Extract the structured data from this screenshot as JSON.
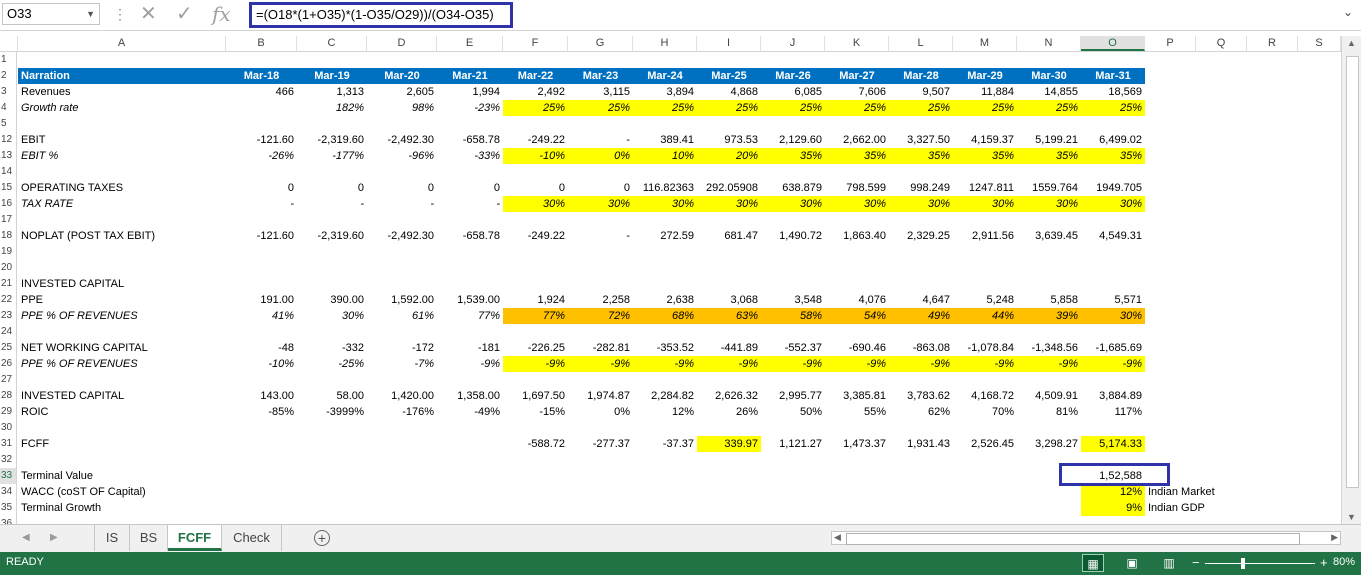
{
  "formula_bar": {
    "name_box": "O33",
    "formula": "=(O18*(1+O35)*(1-O35/O29))/(O34-O35)",
    "icons": [
      "cancel-icon",
      "enter-icon",
      "function-icon"
    ]
  },
  "columns": [
    "A",
    "B",
    "C",
    "D",
    "E",
    "F",
    "G",
    "H",
    "I",
    "J",
    "K",
    "L",
    "M",
    "N",
    "O",
    "P",
    "Q",
    "R",
    "S"
  ],
  "selected_column": "O",
  "selected_row": "33",
  "rows": [
    {
      "n": "1",
      "cells": []
    },
    {
      "n": "2",
      "hdr": true,
      "cells": [
        "Narration",
        "Mar-18",
        "Mar-19",
        "Mar-20",
        "Mar-21",
        "Mar-22",
        "Mar-23",
        "Mar-24",
        "Mar-25",
        "Mar-26",
        "Mar-27",
        "Mar-28",
        "Mar-29",
        "Mar-30",
        "Mar-31"
      ]
    },
    {
      "n": "3",
      "cells": [
        "Revenues",
        "466",
        "1,313",
        "2,605",
        "1,994",
        "2,492",
        "3,115",
        "3,894",
        "4,868",
        "6,085",
        "7,606",
        "9,507",
        "11,884",
        "14,855",
        "18,569"
      ]
    },
    {
      "n": "4",
      "italic": true,
      "fill": "F-O",
      "fillc": "yel",
      "cells": [
        "Growth rate",
        "",
        "182%",
        "98%",
        "-23%",
        "25%",
        "25%",
        "25%",
        "25%",
        "25%",
        "25%",
        "25%",
        "25%",
        "25%",
        "25%"
      ]
    },
    {
      "n": "5",
      "cells": []
    },
    {
      "n": "12",
      "cells": [
        "EBIT",
        "-121.60",
        "-2,319.60",
        "-2,492.30",
        "-658.78",
        "-249.22",
        "-",
        "389.41",
        "973.53",
        "2,129.60",
        "2,662.00",
        "3,327.50",
        "4,159.37",
        "5,199.21",
        "6,499.02"
      ]
    },
    {
      "n": "13",
      "italic": true,
      "fill": "F-O",
      "fillc": "yel",
      "cells": [
        "EBIT %",
        "-26%",
        "-177%",
        "-96%",
        "-33%",
        "-10%",
        "0%",
        "10%",
        "20%",
        "35%",
        "35%",
        "35%",
        "35%",
        "35%",
        "35%"
      ]
    },
    {
      "n": "14",
      "cells": []
    },
    {
      "n": "15",
      "cells": [
        "OPERATING TAXES",
        "0",
        "0",
        "0",
        "0",
        "0",
        "0",
        "116.82363",
        "292.05908",
        "638.879",
        "798.599",
        "998.249",
        "1247.811",
        "1559.764",
        "1949.705"
      ]
    },
    {
      "n": "16",
      "italic": true,
      "fill": "F-O",
      "fillc": "yel",
      "cells": [
        "TAX RATE",
        "-",
        "-",
        "-",
        "-",
        "30%",
        "30%",
        "30%",
        "30%",
        "30%",
        "30%",
        "30%",
        "30%",
        "30%",
        "30%"
      ]
    },
    {
      "n": "17",
      "cells": []
    },
    {
      "n": "18",
      "cells": [
        "NOPLAT (POST TAX EBIT)",
        "-121.60",
        "-2,319.60",
        "-2,492.30",
        "-658.78",
        "-249.22",
        "-",
        "272.59",
        "681.47",
        "1,490.72",
        "1,863.40",
        "2,329.25",
        "2,911.56",
        "3,639.45",
        "4,549.31"
      ]
    },
    {
      "n": "19",
      "cells": []
    },
    {
      "n": "20",
      "cells": []
    },
    {
      "n": "21",
      "cells": [
        "INVESTED CAPITAL"
      ]
    },
    {
      "n": "22",
      "cells": [
        "PPE",
        "191.00",
        "390.00",
        "1,592.00",
        "1,539.00",
        "1,924",
        "2,258",
        "2,638",
        "3,068",
        "3,548",
        "4,076",
        "4,647",
        "5,248",
        "5,858",
        "5,571"
      ]
    },
    {
      "n": "23",
      "italic": true,
      "fill": "F-O",
      "fillc": "org",
      "cells": [
        "PPE % OF REVENUES",
        "41%",
        "30%",
        "61%",
        "77%",
        "77%",
        "72%",
        "68%",
        "63%",
        "58%",
        "54%",
        "49%",
        "44%",
        "39%",
        "30%"
      ]
    },
    {
      "n": "24",
      "cells": []
    },
    {
      "n": "25",
      "cells": [
        "NET WORKING CAPITAL",
        "-48",
        "-332",
        "-172",
        "-181",
        "-226.25",
        "-282.81",
        "-353.52",
        "-441.89",
        "-552.37",
        "-690.46",
        "-863.08",
        "-1,078.84",
        "-1,348.56",
        "-1,685.69"
      ]
    },
    {
      "n": "26",
      "italic": true,
      "fill": "F-O",
      "fillc": "yel",
      "cells": [
        "PPE % OF REVENUES",
        "-10%",
        "-25%",
        "-7%",
        "-9%",
        "-9%",
        "-9%",
        "-9%",
        "-9%",
        "-9%",
        "-9%",
        "-9%",
        "-9%",
        "-9%",
        "-9%"
      ]
    },
    {
      "n": "27",
      "cells": []
    },
    {
      "n": "28",
      "cells": [
        "INVESTED CAPITAL",
        "143.00",
        "58.00",
        "1,420.00",
        "1,358.00",
        "1,697.50",
        "1,974.87",
        "2,284.82",
        "2,626.32",
        "2,995.77",
        "3,385.81",
        "3,783.62",
        "4,168.72",
        "4,509.91",
        "3,884.89"
      ]
    },
    {
      "n": "29",
      "cells": [
        "ROIC",
        "-85%",
        "-3999%",
        "-176%",
        "-49%",
        "-15%",
        "0%",
        "12%",
        "26%",
        "50%",
        "55%",
        "62%",
        "70%",
        "81%",
        "117%"
      ]
    },
    {
      "n": "30",
      "cells": []
    },
    {
      "n": "31",
      "fill": "I,O",
      "fillc": "yel",
      "cells": [
        "FCFF",
        "",
        "",
        "",
        "",
        "-588.72",
        "-277.37",
        "-37.37",
        "339.97",
        "1,121.27",
        "1,473.37",
        "1,931.43",
        "2,526.45",
        "3,298.27",
        "5,174.33"
      ]
    },
    {
      "n": "32",
      "cells": []
    },
    {
      "n": "33",
      "fill": "O",
      "fillc": "none",
      "cells": [
        "Terminal Value",
        "",
        "",
        "",
        "",
        "",
        "",
        "",
        "",
        "",
        "",
        "",
        "",
        "",
        "1,52,588"
      ]
    },
    {
      "n": "34",
      "fill": "O",
      "fillc": "yel",
      "cells": [
        "WACC (coST OF Capital)",
        "",
        "",
        "",
        "",
        "",
        "",
        "",
        "",
        "",
        "",
        "",
        "",
        "",
        "12%",
        "Indian Market"
      ]
    },
    {
      "n": "35",
      "fill": "O",
      "fillc": "yel",
      "cells": [
        "Terminal Growth",
        "",
        "",
        "",
        "",
        "",
        "",
        "",
        "",
        "",
        "",
        "",
        "",
        "",
        "9%",
        "Indian GDP"
      ]
    },
    {
      "n": "36",
      "cells": []
    }
  ],
  "sheet_tabs": [
    "IS",
    "BS",
    "FCFF",
    "Check"
  ],
  "active_tab": "FCFF",
  "status": {
    "mode": "READY",
    "zoom": "80%"
  }
}
